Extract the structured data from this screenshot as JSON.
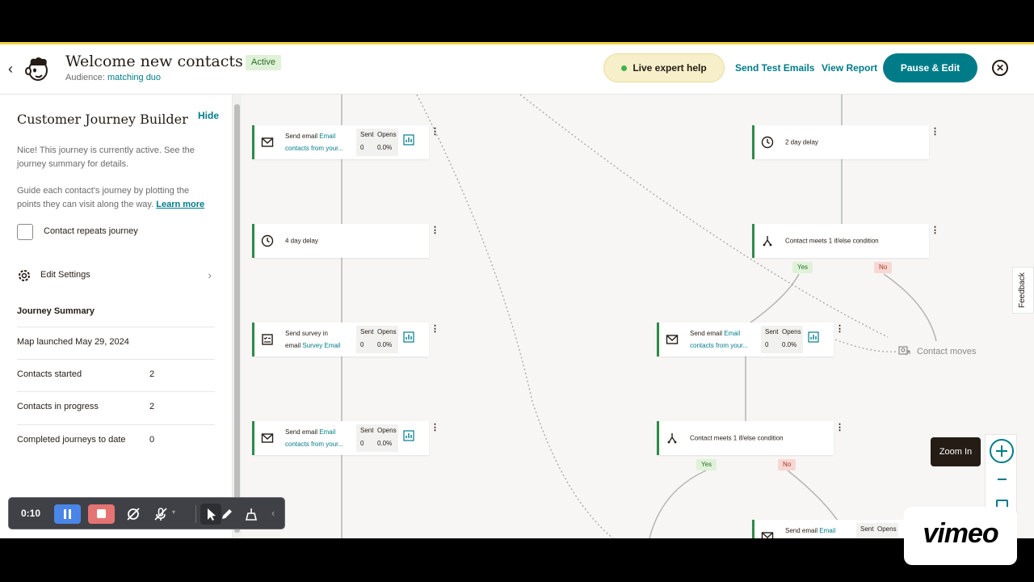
{
  "header": {
    "title": "Welcome new contacts",
    "status": "Active",
    "audience_label": "Audience:",
    "audience_value": "matching duo",
    "help_label": "Live expert help",
    "send_test_label": "Send Test Emails",
    "view_report_label": "View Report",
    "pause_label": "Pause & Edit"
  },
  "sidebar": {
    "title": "Customer Journey Builder",
    "hide_label": "Hide",
    "intro": "Nice! This journey is currently active. See the journey summary for details.",
    "guide": "Guide each contact's journey by plotting the points they can visit along the way.",
    "learn_more": "Learn more",
    "repeat_label": "Contact repeats journey",
    "settings_label": "Edit Settings",
    "summary_title": "Journey Summary",
    "launched": "Map launched May 29, 2024",
    "rows": [
      {
        "label": "Contacts started",
        "value": "2"
      },
      {
        "label": "Contacts in progress",
        "value": "2"
      },
      {
        "label": "Completed journeys to date",
        "value": "0"
      }
    ]
  },
  "canvas": {
    "stat_sent": "Sent",
    "stat_opens": "Opens",
    "val_sent": "0",
    "val_opens": "0.0%",
    "nodes": {
      "email1": {
        "line1": "Send email",
        "link1": "Email",
        "line2": "contacts from your..."
      },
      "delay1": {
        "text": "4 day delay"
      },
      "survey": {
        "line1": "Send survey in",
        "line2": "email",
        "link2": "Survey Email"
      },
      "email2": {
        "line1": "Send email",
        "link1": "Email",
        "line2": "contacts from your..."
      },
      "delay2": {
        "text": "2 day delay"
      },
      "cond1": {
        "text": "Contact meets 1 if/else condition"
      },
      "email3": {
        "line1": "Send email",
        "link1": "Email",
        "line2": "contacts from your..."
      },
      "cond2": {
        "text": "Contact meets 1 if/else condition"
      },
      "email4": {
        "line1": "Send email",
        "link1": "Email"
      }
    },
    "yes": "Yes",
    "no": "No",
    "contact_moves": "Contact moves",
    "feedback": "Feedback",
    "zoom_tip": "Zoom In"
  },
  "recorder": {
    "time": "0:10"
  },
  "watermark": "vimeo",
  "colors": {
    "brand_teal": "#007c89",
    "active_green": "#2f8a4a",
    "help_yellow": "#f6efc9"
  }
}
